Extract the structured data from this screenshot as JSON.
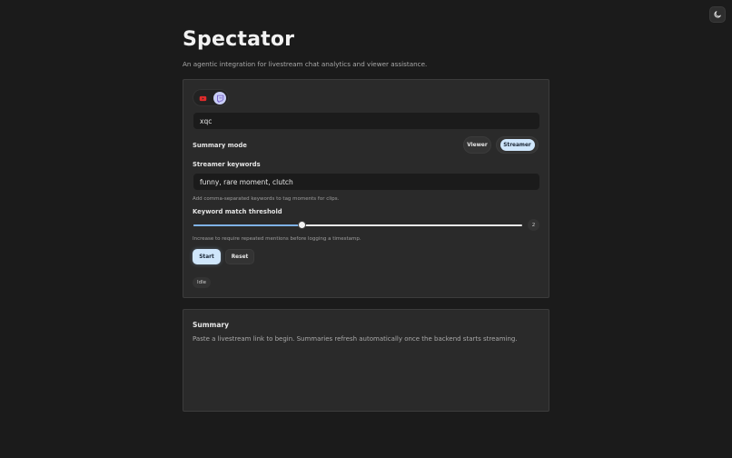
{
  "app": {
    "title": "Spectator",
    "subtitle": "An agentic integration for livestream chat analytics and viewer assistance."
  },
  "header": {
    "theme_toggle_icon": "moon-icon"
  },
  "platforms": {
    "items": [
      {
        "name": "YouTube",
        "icon": "youtube-icon",
        "color": "#e02b2b",
        "selected": false
      },
      {
        "name": "Twitch",
        "icon": "twitch-icon",
        "color": "#6f57c7",
        "selected": true
      }
    ]
  },
  "channel": {
    "value": "xqc"
  },
  "summary_mode": {
    "label": "Summary mode",
    "options": [
      "Viewer",
      "Streamer"
    ],
    "selected": "Streamer"
  },
  "streamer_keywords": {
    "label": "Streamer keywords",
    "value": "funny, rare moment, clutch",
    "hint": "Add comma-separated keywords to tag moments for clips."
  },
  "threshold": {
    "label": "Keyword match threshold",
    "value": "2",
    "fraction": 0.33,
    "hint": "Increase to require repeated mentions before logging a timestamp."
  },
  "actions": {
    "start": "Start",
    "reset": "Reset"
  },
  "status": "Idle",
  "summary": {
    "title": "Summary",
    "text": "Paste a livestream link to begin. Summaries refresh automatically once the backend starts streaming."
  },
  "colors": {
    "accent": "#cfe6fb",
    "slider_fill": "#7fb2e6",
    "background": "#1b1b1b",
    "card": "#2a2a2a"
  }
}
